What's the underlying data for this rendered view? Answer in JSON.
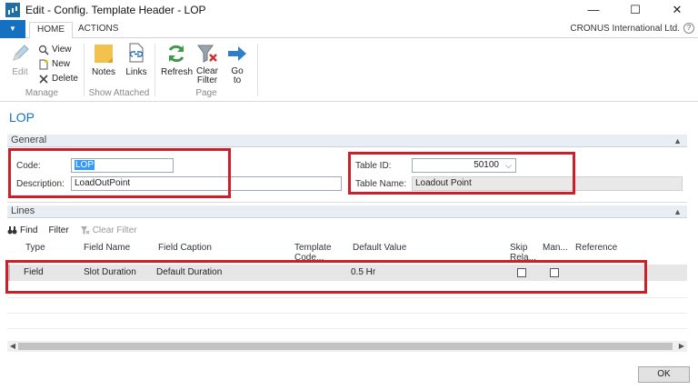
{
  "window": {
    "title": "Edit - Config. Template Header - LOP",
    "minimize": "—",
    "maximize": "☐",
    "close": "✕"
  },
  "ribbon_tabs": {
    "file": "▼",
    "home": "HOME",
    "actions": "ACTIONS",
    "company": "CRONUS International Ltd.",
    "help": "?"
  },
  "ribbon": {
    "manage": {
      "label": "Manage",
      "edit": "Edit",
      "view": "View",
      "new": "New",
      "delete": "Delete"
    },
    "show_attached": {
      "label": "Show Attached",
      "notes": "Notes",
      "links": "Links"
    },
    "page": {
      "label": "Page",
      "refresh": "Refresh",
      "clear_filter_line1": "Clear",
      "clear_filter_line2": "Filter",
      "goto_line1": "Go",
      "goto_line2": "to"
    }
  },
  "page_title": "LOP",
  "general": {
    "header": "General",
    "code_label": "Code:",
    "code_value": "LOP",
    "description_label": "Description:",
    "description_value": "LoadOutPoint",
    "table_id_label": "Table ID:",
    "table_id_value": "50100",
    "table_name_label": "Table Name:",
    "table_name_value": "Loadout Point"
  },
  "lines": {
    "header": "Lines",
    "toolbar": {
      "find": "Find",
      "filter": "Filter",
      "clear_filter": "Clear Filter"
    },
    "columns": {
      "type": "Type",
      "field_name": "Field Name",
      "field_caption": "Field Caption",
      "template_code_1": "Template",
      "template_code_2": "Code...",
      "default_value": "Default Value",
      "skip_rela_1": "Skip",
      "skip_rela_2": "Rela...",
      "mandatory": "Man...",
      "reference": "Reference"
    },
    "rows": [
      {
        "type": "Field",
        "field_name": "Slot Duration",
        "field_caption": "Default Duration",
        "default_value": "0.5 Hr"
      }
    ]
  },
  "scrollbar": {
    "left": "◀",
    "right": "▶"
  },
  "ok_button": "OK"
}
